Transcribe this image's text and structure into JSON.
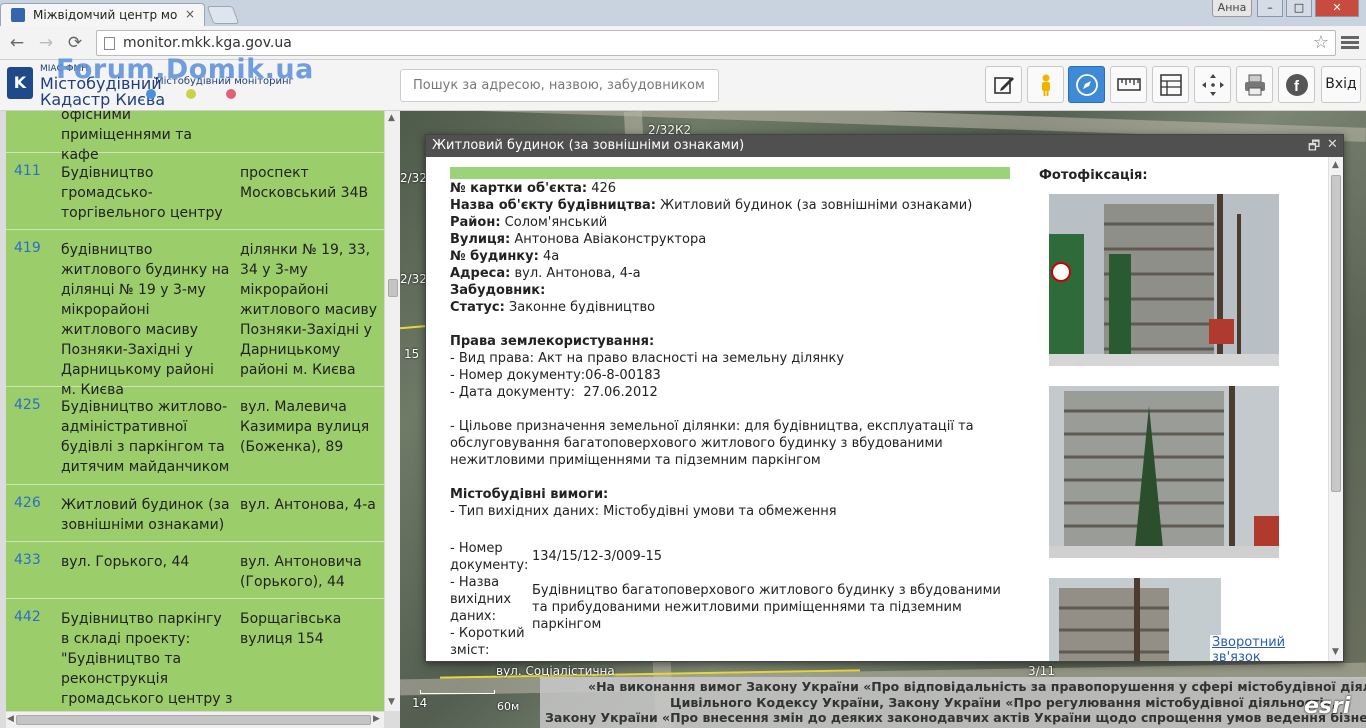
{
  "browser": {
    "tab_title": "Міжвідомчий центр мон",
    "tab_close": "×",
    "user_name": "Анна",
    "url": "monitor.mkk.kga.gov.ua",
    "win_min": "–",
    "win_max": "□",
    "win_close": "✕",
    "back_glyph": "←",
    "forward_glyph": "→",
    "reload_glyph": "⟳",
    "star_glyph": "☆"
  },
  "header": {
    "logo_small": "МІАС ФМН",
    "logo_line1": "Містобудівний",
    "logo_line2": "Кадастр Києва",
    "logo_sub": "Містобудівний моніторинг",
    "watermark": "Forum.Domik.ua",
    "search_placeholder": "Пошук за адресою, назвою, забудовником...",
    "login_label": "Вхід",
    "dot_colors": [
      "#4a90d9",
      "#c9d34a",
      "#e0607a"
    ],
    "tools": [
      "edit-icon",
      "person-icon",
      "compass-icon",
      "ruler-icon",
      "layers-icon",
      "crosshair-icon",
      "print-icon",
      "facebook-icon"
    ]
  },
  "list": {
    "rows": [
      {
        "num": "",
        "name": "офісними приміщеннями та кафе",
        "addr": ""
      },
      {
        "num": "411",
        "name": "Будівництво громадсько-торгівельного центру",
        "addr": "проспект Московський 34В"
      },
      {
        "num": "419",
        "name": "будівництво житлового будинку на ділянці № 19 у 3-му мікрорайоні житлового масиву Позняки-Західні у Дарницькому районі м. Києва",
        "addr": "ділянки № 19, 33, 34 у 3-му мікрорайоні житлового масиву Позняки-Західні у Дарницькому районі м. Києва"
      },
      {
        "num": "425",
        "name": "Будівництво житлово-адміністративної будівлі з паркінгом та дитячим майданчиком",
        "addr": "вул. Малевича Казимира вулиця (Боженка), 89"
      },
      {
        "num": "426",
        "name": "Житловий будинок (за зовнішніми ознаками)",
        "addr": "вул. Антонова, 4-а"
      },
      {
        "num": "433",
        "name": "вул. Горького, 44",
        "addr": "вул. Антоновича (Горького), 44"
      },
      {
        "num": "442",
        "name": "Будівництво паркінгу в складі проекту: \"Будівництво та реконструкція громадського центру з",
        "addr": "Борщагівська вулиця 154"
      }
    ]
  },
  "map": {
    "labels": [
      "2/32К2",
      "2/32",
      "2/32",
      "15",
      "вул. Соціалістична",
      "3/11",
      "14",
      "60м"
    ]
  },
  "popup": {
    "title": "Житловий будинок (за зовнішніми ознаками)",
    "photo_title": "Фотофіксація:",
    "feedback": "Зворотний зв'язок",
    "lines": [
      {
        "k": "№ картки об'єкта:",
        "v": " 426"
      },
      {
        "k": "Назва об'єкту будівництва:",
        "v": " Житловий будинок (за зовнішніми ознаками)"
      },
      {
        "k": "Район:",
        "v": " Солом'янський"
      },
      {
        "k": "Вулиця:",
        "v": " Антонова Авіаконструктора"
      },
      {
        "k": "№ будинку:",
        "v": " 4а"
      },
      {
        "k": "Адреса:",
        "v": " вул. Антонова, 4-а"
      },
      {
        "k": "Забудовник:",
        "v": ""
      },
      {
        "k": "Статус:",
        "v": " Законне будівництво"
      }
    ],
    "land_title": "Права землекористування:",
    "land_type": "- Вид права: Акт на право власності на земельну ділянку",
    "land_docnum": "- Номер документу:06-8-00183",
    "land_docdate": "- Дата документу:  27.06.2012",
    "land_purpose": "- Цільове призначення земельної ділянки: для будівництва, експлуатації та обслуговування багатоповерхового житлового будинку з вбудованими нежитловими приміщеннями та підземним паркінгом",
    "req_title": "Містобудівні вимоги:",
    "req_type": "- Тип вихідних даних: Містобудівні умови та обмеження",
    "req_num_label": "- Номер документу:",
    "req_num_value": "134/15/12-3/009-15",
    "req_name_label": "- Назва вихідних даних:",
    "req_name_value": "Будівництво багатоповерхового житлового будинку з вбудованими та прибудованими нежитловими приміщеннями та підземним паркінгом",
    "req_summary_label": "- Короткий зміст:"
  },
  "legal": {
    "line1": "«На виконання вимог Закону України «Про відповідальність за правопорушення у сфері містобудівної діяльності»,",
    "line2": "Цивільного Кодексу України, Закону України «Про регулювання містобудівної діяльності»,",
    "line3": "Закону України «Про внесення змін до деяких законодавчих актів України щодо спрощення умов ведення бізнесу (дерегуляц"
  },
  "esri": "esri"
}
